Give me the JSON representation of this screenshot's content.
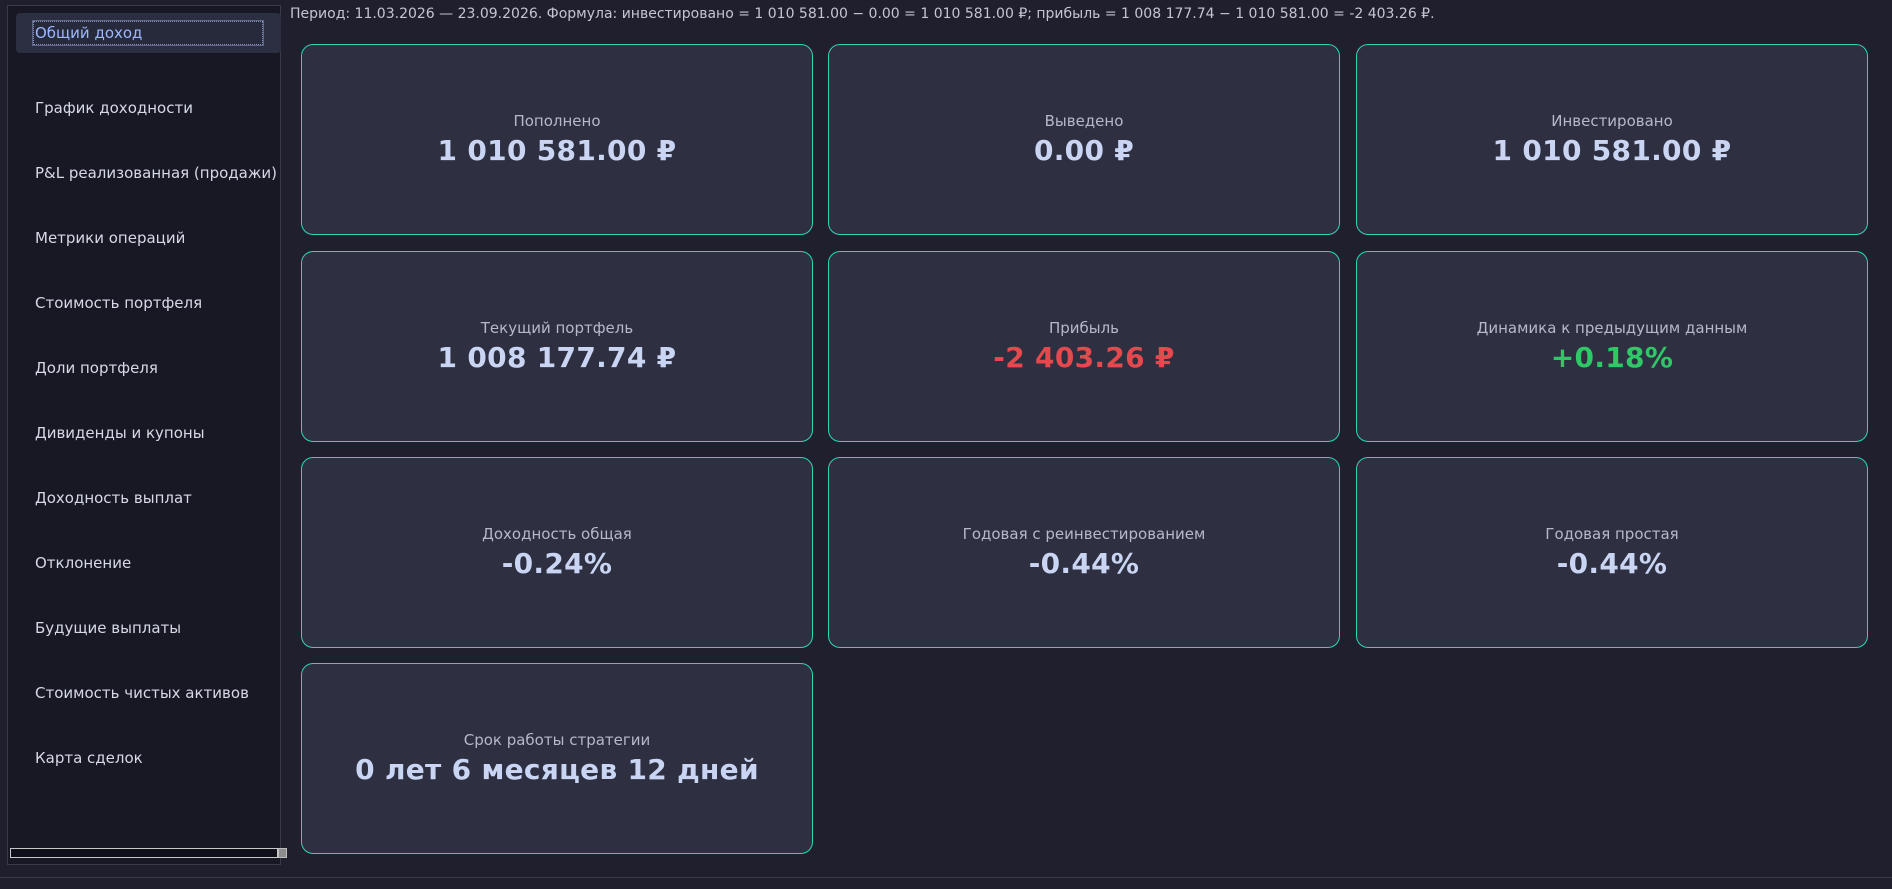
{
  "header": {
    "formula": "Период: 11.03.2026 — 23.09.2026. Формула: инвестировано = 1 010 581.00 − 0.00 = 1 010 581.00 ₽; прибыль = 1 008 177.74 − 1 010 581.00 = -2 403.26 ₽."
  },
  "sidebar": {
    "items": [
      {
        "label": "Общий доход",
        "active": true
      },
      {
        "label": "График доходности"
      },
      {
        "label": "P&L реализованная (продажи)"
      },
      {
        "label": "Метрики операций"
      },
      {
        "label": "Стоимость портфеля"
      },
      {
        "label": "Доли портфеля"
      },
      {
        "label": "Дивиденды и купоны"
      },
      {
        "label": "Доходность выплат"
      },
      {
        "label": "Отклонение"
      },
      {
        "label": "Будущие выплаты"
      },
      {
        "label": "Стоимость чистых активов"
      },
      {
        "label": "Карта сделок"
      }
    ]
  },
  "cards": [
    {
      "label": "Пополнено",
      "value": "1 010 581.00 ₽"
    },
    {
      "label": "Выведено",
      "value": "0.00 ₽"
    },
    {
      "label": "Инвестировано",
      "value": "1 010 581.00 ₽"
    },
    {
      "label": "Текущий портфель",
      "value": "1 008 177.74 ₽"
    },
    {
      "label": "Прибыль",
      "value": "-2 403.26 ₽",
      "tone": "negative"
    },
    {
      "label": "Динамика к предыдущим данным",
      "value": "+0.18%",
      "tone": "positive"
    },
    {
      "label": "Доходность общая",
      "value": "-0.24%"
    },
    {
      "label": "Годовая с реинвестированием",
      "value": "-0.44%"
    },
    {
      "label": "Годовая простая",
      "value": "-0.44%"
    },
    {
      "label": "Срок работы стратегии",
      "value": "0 лет 6 месяцев 12 дней"
    }
  ],
  "colors": {
    "background": "#1f1f2e",
    "card_border": "#2fd6b0",
    "negative": "#e5484d",
    "positive": "#2ec866"
  }
}
